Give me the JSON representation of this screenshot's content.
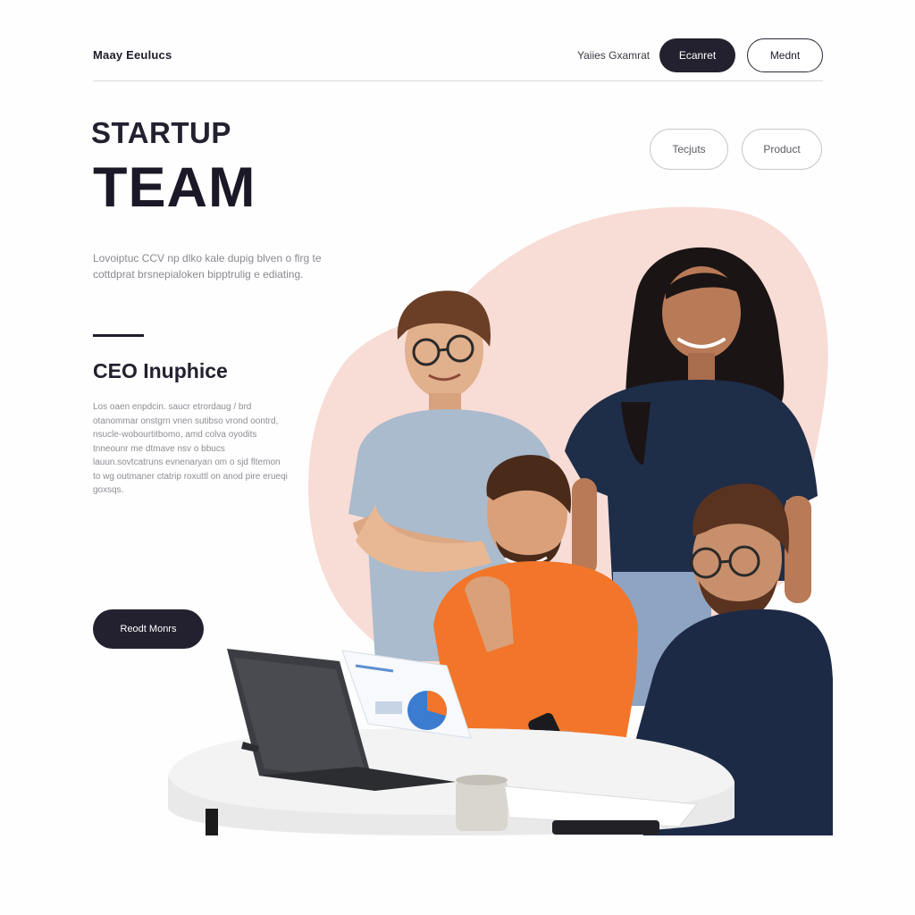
{
  "header": {
    "brand": "Maay Eeulucs",
    "nav_link": "Yaiies Gxamrat",
    "connect_label": "Ecanret",
    "meet_label": "Mednt"
  },
  "hero": {
    "line1": "STARTUP",
    "line2": "TEAM",
    "features_label": "Tecjuts",
    "product_label": "Product",
    "intro_text": "Lovoiptuc CCV np dlko kale dupig blven o flrg te cottdprat brsnepialoken bipptrulig e ediating."
  },
  "profile": {
    "role_title": "CEO Inuphice",
    "description": "Los oaen enpdcin. saucr etrordaug / brd otanommar onstgrn vnen sutibso vrond oontrd, nsucle-wobourtitbomo, amd colva oyodits tnneounr me dtmave nsv o bbucs lauun.sovtcatruns evnenaryan om o sjd fltemon to wg outmaner ctatrip roxuttl on anod pire erueqi goxsqs.",
    "read_more_label": "Reodt Monrs"
  },
  "colors": {
    "accent_dark": "#23202f",
    "blob_pink": "#f8dcd6",
    "orange_shirt": "#f2752a",
    "navy_shirt": "#1e2d48",
    "grey_blue_shirt": "#9fb1c4"
  }
}
